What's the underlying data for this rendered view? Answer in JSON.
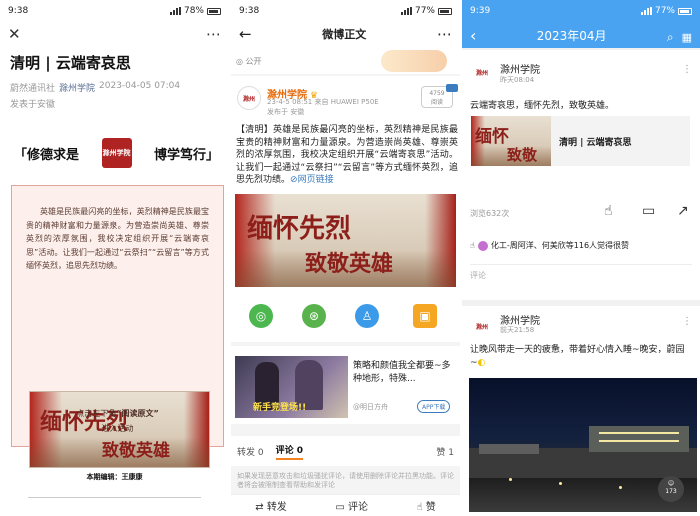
{
  "p1": {
    "time": "9:38",
    "battery": "78%",
    "title": "清明 | 云端寄哀思",
    "source": "蔚然通讯社",
    "account": "滁州学院",
    "date": "2023-04-05 07:04",
    "location": "发表于安徽",
    "banner_left": "「修德求是",
    "banner_seal": "滁州学院",
    "banner_right": "博学笃行」",
    "body": "英雄是民族最闪亮的坐标，英烈精神是民族最宝贵的精神财富和力量源泉。为营造崇尚英雄、尊崇英烈的浓厚氛围，我校决定组织开展“云端寄哀思”活动。让我们一起通过“云祭扫”“云留言”等方式缅怀英烈，追思先烈功绩。",
    "cta_prefix": "点击左下角",
    "cta_bold": "“阅读原文”",
    "cta_suffix": "进入活动",
    "editor": "本期编辑：王康康",
    "poster_line1": "缅怀先烈",
    "poster_line2": "致敬英雄"
  },
  "p2": {
    "time": "9:38",
    "battery": "77%",
    "nav_title": "微博正文",
    "public": "公开",
    "name": "滁州学院",
    "time_info": "23-4-5 08:51 来自 HUAWEI P50E",
    "location": "发布于 安徽",
    "views": "4759",
    "views_unit": "阅读",
    "text": "【清明】英雄是民族最闪亮的坐标，英烈精神是民族最宝贵的精神财富和力量源泉。为营造崇尚英雄、尊崇英烈的浓厚氛围，我校决定组织开展“云端寄哀思”活动。让我们一起通过“云祭扫”“云留言”等方式缅怀英烈，追思先烈功绩。",
    "link_text": "网页链接",
    "poster_line1": "缅怀先烈",
    "poster_line2": "致敬英雄",
    "ad_title": "策略和颜值我全都要~多种地形，特殊...",
    "ad_source": "@明日方舟",
    "ad_button": "APP下载",
    "ad_banner": "新手竞登场!!",
    "tab_repost": "转发 0",
    "tab_comment": "评论 0",
    "tab_like": "赞 1",
    "comment_notice": "如果发现恶意攻击和垃圾骚扰评论，请使用删除评论并拉黑功能。评论者将会被限制查看帮助和发评论",
    "bot_repost": "转发",
    "bot_comment": "评论",
    "bot_like": "赞"
  },
  "p3": {
    "time": "9:39",
    "battery": "77%",
    "month": "2023年04月",
    "post1": {
      "name": "滁州学院",
      "time": "昨天08:04",
      "text": "云端寄哀思，缅怀先烈，致敬英雄。",
      "link_title": "清明 | 云端寄哀思",
      "poster_line1": "缅怀",
      "poster_line2": "致敬",
      "views": "浏览632次",
      "likes": "化工-周阿洋、何美欣等116人觉得很赞",
      "comment": "评论"
    },
    "post2": {
      "name": "滁州学院",
      "time": "前天21:58",
      "text": "让晚风带走一天的疲惫，带着好心情入睡~晚安，蔚园~",
      "badge": "173"
    }
  }
}
